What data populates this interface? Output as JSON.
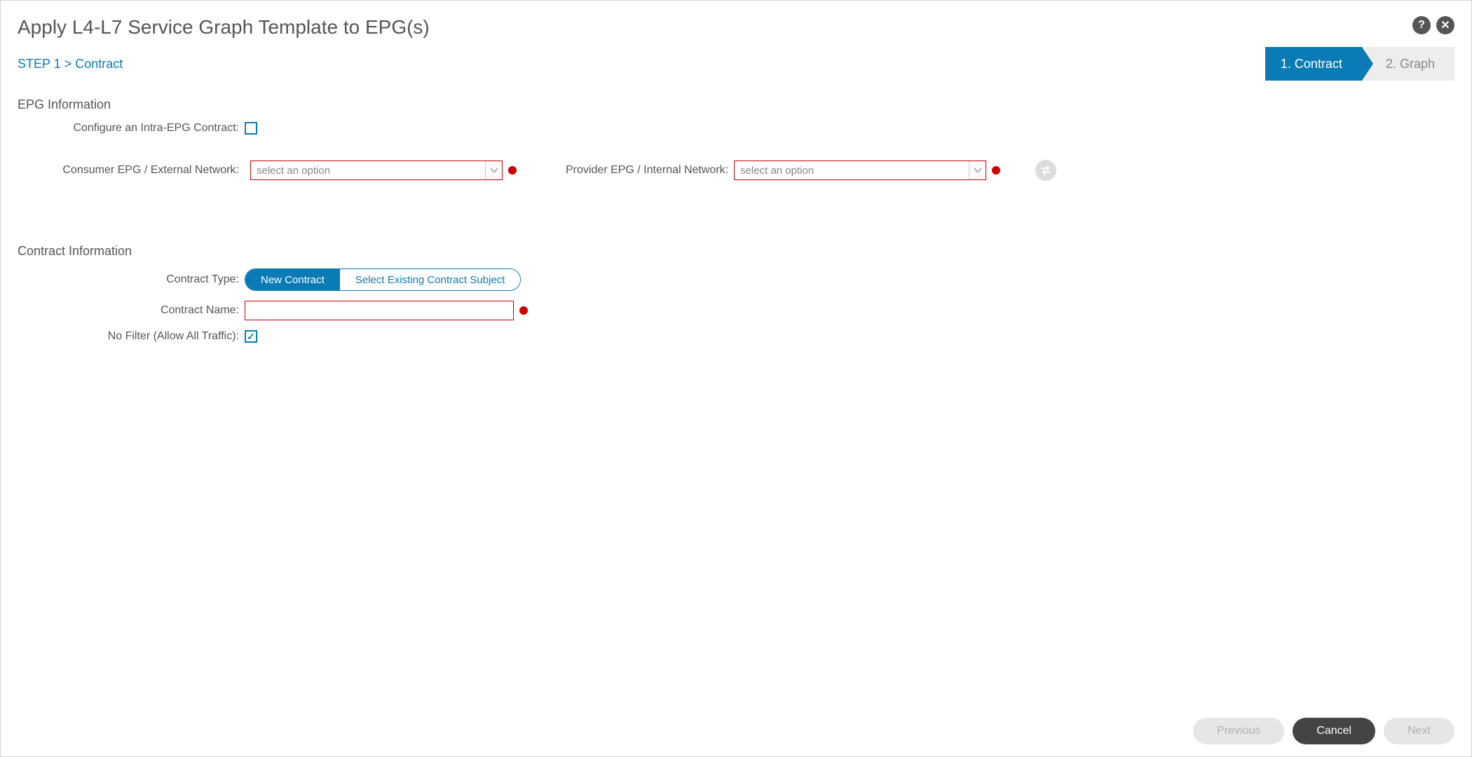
{
  "title": "Apply L4-L7 Service Graph Template to EPG(s)",
  "breadcrumb": "STEP 1 > Contract",
  "steps": {
    "s1": "1. Contract",
    "s2": "2. Graph"
  },
  "epg": {
    "section": "EPG Information",
    "intra_label": "Configure an Intra-EPG Contract:",
    "consumer_label": "Consumer EPG / External Network:",
    "consumer_placeholder": "select an option",
    "provider_label": "Provider EPG / Internal Network:",
    "provider_placeholder": "select an option"
  },
  "contract": {
    "section": "Contract Information",
    "type_label": "Contract Type:",
    "type_new": "New Contract",
    "type_existing": "Select Existing Contract Subject",
    "name_label": "Contract Name:",
    "name_value": "",
    "filter_label": "No Filter (Allow All Traffic):"
  },
  "footer": {
    "previous": "Previous",
    "cancel": "Cancel",
    "next": "Next"
  }
}
